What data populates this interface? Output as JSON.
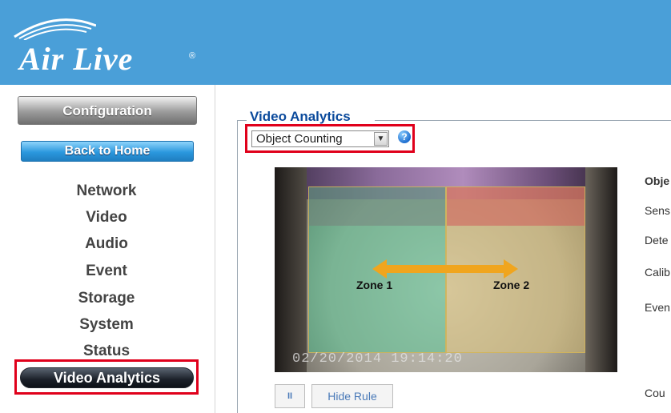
{
  "header": {
    "logo_text": "Air Live",
    "logo_mark": "®"
  },
  "sidebar": {
    "config_label": "Configuration",
    "home_label": "Back to Home",
    "nav": [
      "Network",
      "Video",
      "Audio",
      "Event",
      "Storage",
      "System",
      "Status"
    ],
    "active_label": "Video Analytics"
  },
  "main": {
    "section_title": "Video Analytics",
    "mode_select": {
      "value": "Object Counting"
    },
    "help_icon": "question-icon",
    "video": {
      "zone1_label": "Zone 1",
      "zone2_label": "Zone 2",
      "timestamp": "02/20/2014   19:14:20"
    },
    "controls": {
      "pause_label": "II",
      "hide_rule_label": "Hide Rule"
    },
    "properties": [
      "Obje",
      "Sens",
      "Dete",
      "Calib",
      "Even",
      "Cou"
    ]
  },
  "colors": {
    "header_bg": "#4a9fd8",
    "highlight": "#e0001b",
    "title": "#0b4a9c",
    "zone1": "#3ac88c",
    "zone2": "#e6c86e",
    "arrow": "#f0a51e"
  }
}
